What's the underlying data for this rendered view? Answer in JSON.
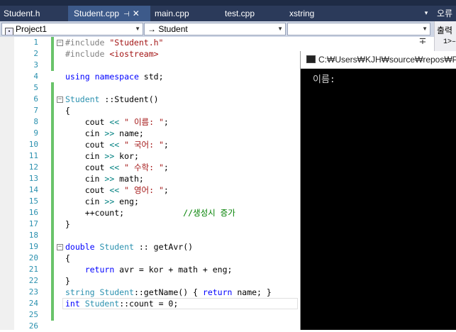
{
  "tabs": [
    {
      "label": "Student.h"
    },
    {
      "label": "Student.cpp",
      "pin": "⊣",
      "close": "✕"
    },
    {
      "label": "main.cpp"
    },
    {
      "label": "test.cpp"
    },
    {
      "label": "xstring"
    }
  ],
  "tab_overflow": "▾",
  "right_panel": {
    "header": "오류",
    "button": "출력",
    "line": "1>–"
  },
  "navbar": {
    "project": "Project1",
    "scope": "→ Student",
    "member": ""
  },
  "split_icon": "∓",
  "line_numbers": [
    "1",
    "2",
    "3",
    "4",
    "5",
    "6",
    "7",
    "8",
    "9",
    "10",
    "11",
    "12",
    "13",
    "14",
    "15",
    "16",
    "17",
    "18",
    "19",
    "20",
    "21",
    "22",
    "23",
    "24",
    "25",
    "26"
  ],
  "code": {
    "l1a": "#include ",
    "l1b": "\"Student.h\"",
    "l2a": "#include ",
    "l2b": "<iostream>",
    "l4a": "using",
    "l4b": " ",
    "l4c": "namespace",
    "l4d": " std;",
    "l6a": "Student",
    "l6b": " ::",
    "l6c": "Student()",
    "l7": "{",
    "l8a": "    cout ",
    "l8b": "<<",
    "l8c": " ",
    "l8d": "\" 이름: \"",
    ";": ";",
    "l8e": ";",
    "l9a": "    cin ",
    "l9b": ">>",
    "l9c": " name;",
    "l10a": "    cout ",
    "l10b": "<<",
    "l10c": " ",
    "l10d": "\" 국어: \"",
    "l10e": ";",
    "l11a": "    cin ",
    "l11b": ">>",
    "l11c": " kor;",
    "l12a": "    cout ",
    "l12b": "<<",
    "l12c": " ",
    "l12d": "\" 수학: \"",
    "l12e": ";",
    "l13a": "    cin ",
    "l13b": ">>",
    "l13c": " math;",
    "l14a": "    cout ",
    "l14b": "<<",
    "l14c": " ",
    "l14d": "\" 영어: \"",
    "l14e": ";",
    "l15a": "    cin ",
    "l15b": ">>",
    "l15c": " eng;",
    "l16a": "    ++count;            ",
    "l16b": "//생성시 증가",
    "l17": "}",
    "l19a": "double",
    "l19b": " ",
    "l19c": "Student",
    "l19d": " :: getAvr()",
    "l20": "{",
    "l21a": "    ",
    "l21b": "return",
    "l21c": " avr = kor + math + eng;",
    "l22": "}",
    "l23a": "string",
    "l23b": " ",
    "l23c": "Student",
    "l23d": "::getName() { ",
    "l23e": "return",
    "l23f": " name; }",
    "l24a": "int",
    "l24b": " ",
    "l24c": "Student",
    "l24d": "::count = 0;"
  },
  "console": {
    "title": "C:₩Users₩KJH₩source₩repos₩Proj",
    "output": "이름: "
  }
}
